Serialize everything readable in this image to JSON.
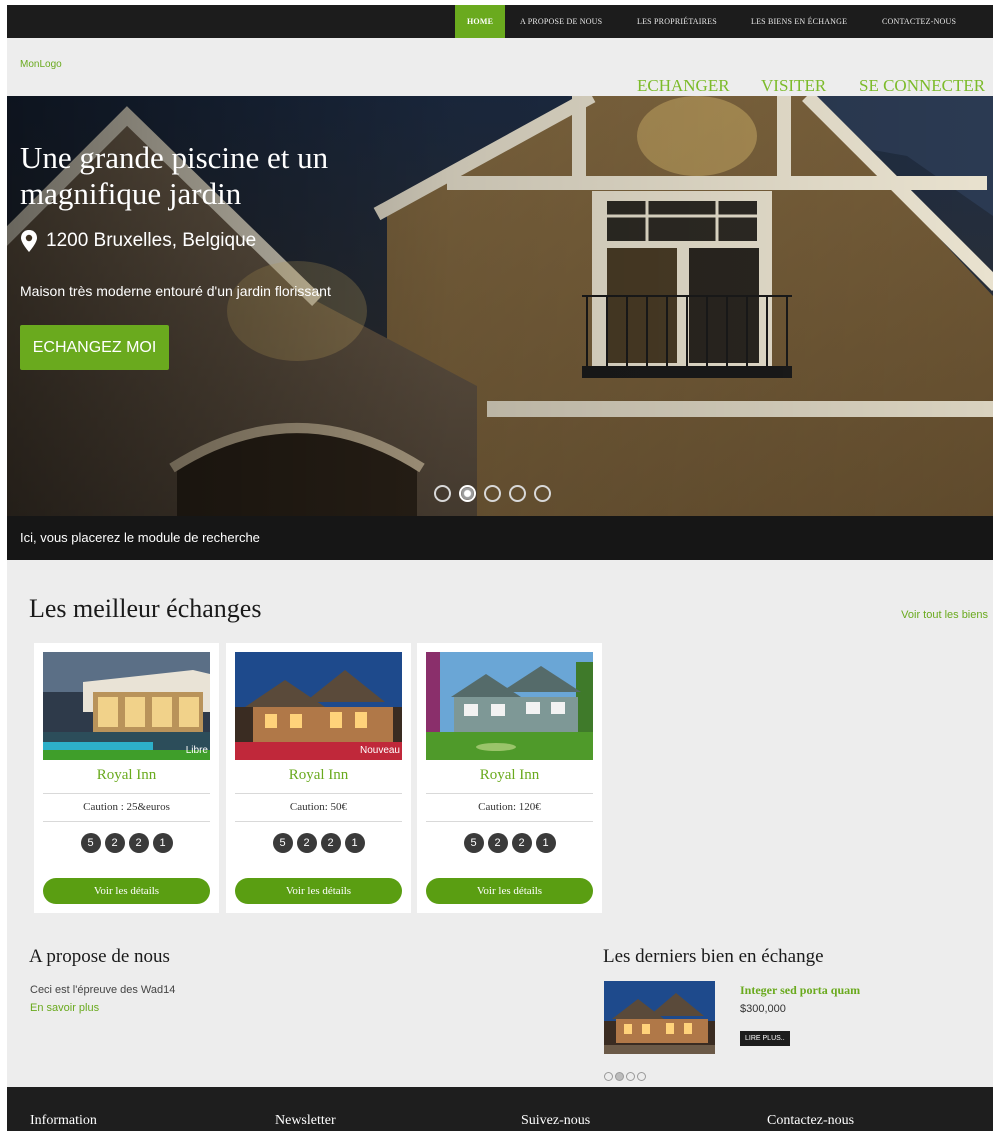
{
  "nav": {
    "items": [
      {
        "label": "Home",
        "active": true
      },
      {
        "label": "A propose de nous"
      },
      {
        "label": "Les propriétaires"
      },
      {
        "label": "Les biens en échange"
      },
      {
        "label": "Contactez-nous"
      }
    ]
  },
  "brand": {
    "logo_text": "MonLogo",
    "accent_color": "#6aaa1e"
  },
  "actions": [
    "ECHANGER",
    "VISITER",
    "SE CONNECTER"
  ],
  "hero": {
    "title": "Une grande piscine et un magnifique jardin",
    "location_icon": "map-pin-icon",
    "location": "1200 Bruxelles, Belgique",
    "description": "Maison très moderne entouré d'un jardin florissant",
    "cta_label": "ECHANGEZ MOI",
    "slider": {
      "count": 5,
      "active_index": 2
    }
  },
  "search": {
    "text": "Ici, vous placerez le module de recherche"
  },
  "best": {
    "title": "Les meilleur échanges",
    "see_all": "Voir tout les biens",
    "cards": [
      {
        "name": "Royal Inn",
        "badge": "Libre",
        "price": "Caution : 25&euros",
        "features": [
          "5",
          "2",
          "2",
          "1"
        ],
        "button": "Voir les détails"
      },
      {
        "name": "Royal Inn",
        "badge": "Nouveau",
        "price": "Caution: 50€",
        "features": [
          "5",
          "2",
          "2",
          "1"
        ],
        "button": "Voir les détails"
      },
      {
        "name": "Royal Inn",
        "badge": "",
        "price": "Caution: 120€",
        "features": [
          "5",
          "2",
          "2",
          "1"
        ],
        "button": "Voir les détails"
      }
    ]
  },
  "about": {
    "title": "A propose de nous",
    "text": "Ceci est l'épreuve des Wad14",
    "link": "En savoir plus"
  },
  "latest": {
    "title": "Les derniers bien en échange",
    "item": {
      "name": "Integer sed porta quam",
      "price": "$300,000",
      "button": "Lire plus.."
    },
    "slider": {
      "count": 4,
      "active_index": 2
    }
  },
  "footer": {
    "columns": [
      "Information",
      "Newsletter",
      "Suivez-nous",
      "Contactez-nous"
    ]
  }
}
